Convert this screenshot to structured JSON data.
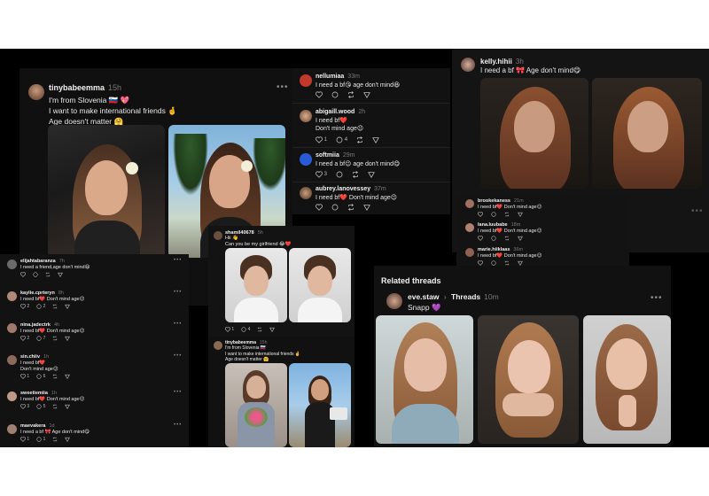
{
  "main_post": {
    "username": "tinybabeemma",
    "time": "15h",
    "line1": "I'm from Slovenia 🇸🇮 💖",
    "line2": "I want to make international friends 🤞",
    "line3": "Age doesn't matter 🤗"
  },
  "replies_top": [
    {
      "username": "nellumiaa",
      "time": "33m",
      "text": "I need a bf😘 age don't mind😆"
    },
    {
      "username": "abigaill.wood",
      "time": "2h",
      "text": "I need bf❤️",
      "text2": "Don't mind age😉",
      "likes": "1",
      "replies": "4"
    },
    {
      "username": "softmiia",
      "time": "29m",
      "text": "I need a bf😉 age don't mind😋",
      "likes": "3"
    },
    {
      "username": "aubrey.lanovessey",
      "time": "37m",
      "text": "I need bf❤️ Don't mind age😉"
    }
  ],
  "kelly_post": {
    "username": "kelly.hihii",
    "time": "3h",
    "text": "I need a bf 🎀 Age don't mind😋"
  },
  "replies_small_right": [
    {
      "username": "brookekaness",
      "time": "21m",
      "text": "I need bf❤️ Don't mind age😉"
    },
    {
      "username": "lana.luubabe",
      "time": "18m",
      "text": "I need bf❤️ Don't mind age😉"
    },
    {
      "username": "marie.hiiklaas",
      "time": "36m",
      "text": "I need bf❤️ Don't mind age😉"
    }
  ],
  "left_list": [
    {
      "username": "elijahtabaranza",
      "time": "7h",
      "text": "I need a friend,age don't mind😆"
    },
    {
      "username": "kaylie.cprteryn",
      "time": "8h",
      "text": "I need bf❤️ Don't mind age😉",
      "likes": "2",
      "replies": "2"
    },
    {
      "username": "nina.jadectrk",
      "time": "4h",
      "text": "I need bf❤️ Don't mind age😉",
      "likes": "2",
      "replies": "7"
    },
    {
      "username": "sin.chiiv",
      "time": "1h",
      "text": "I need bf❤️",
      "text2": "Don't mind age😉",
      "likes": "1",
      "replies": "6"
    },
    {
      "username": "sweetiemiia",
      "time": "1h",
      "text": "I need bf❤️ Don't mind age😉",
      "likes": "3",
      "replies": "5"
    },
    {
      "username": "maevakera",
      "time": "1d",
      "text": "I need a bf 🎀 Age don't mind😋",
      "likes": "1",
      "replies": "1"
    }
  ],
  "middle_post": {
    "username": "shamil40678",
    "time": "5h",
    "line1": "Hii 👋",
    "line2": "Can you be my girlfriend 😂❤️",
    "likes": "1",
    "replies": "4"
  },
  "middle_bottom_post": {
    "username": "tinybabeemma",
    "time": "15h",
    "line1": "I'm from Slovenia 🇸🇮",
    "line2": "I want to make international friends 🤞",
    "line3": "Age doesn't matter 🤗"
  },
  "related": {
    "heading": "Related threads",
    "username": "eve.staw",
    "source": "Threads",
    "time": "10m",
    "text": "Snapp 💜"
  },
  "icons": [
    "heart-icon",
    "comment-icon",
    "repost-icon",
    "share-icon",
    "more-icon"
  ],
  "colors": {
    "bg": "#000000",
    "panel": "#101010",
    "text": "#e8e8e8",
    "muted": "#7a7a7a"
  }
}
